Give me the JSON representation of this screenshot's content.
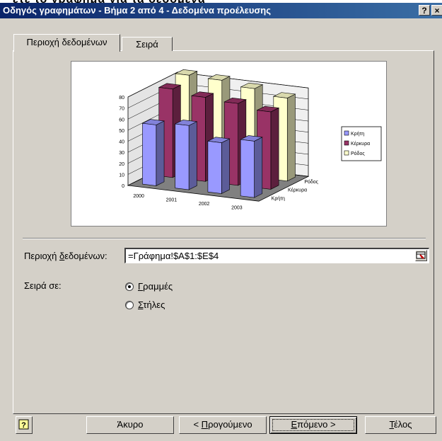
{
  "window": {
    "title": "Οδηγός γραφημάτων - Βήμα 2 από 4 - Δεδομένα προέλευσης",
    "help_btn": "?",
    "close_btn": "×",
    "behind_text": "ετε το γράφημα για τα δεδομένα"
  },
  "tabs": [
    {
      "label": "Περιοχή δεδομένων",
      "selected": true
    },
    {
      "label": "Σειρά",
      "selected": false
    }
  ],
  "form": {
    "data_range_label": "Περιοχή δεδομένων:",
    "data_range_label_pre": "Περιοχή ",
    "data_range_label_ul": "δ",
    "data_range_label_post": "εδομένων:",
    "data_range_value": "=Γράφημα!$A$1:$E$4",
    "series_in_label": "Σειρά σε:",
    "option_rows": {
      "ul": "Γ",
      "rest": "ραμμές",
      "selected": true
    },
    "option_cols": {
      "ul": "Σ",
      "rest": "τήλες",
      "selected": false
    }
  },
  "buttons": {
    "help_icon": "?",
    "cancel": "Άκυρο",
    "back_pre": "< ",
    "back_ul": "Π",
    "back_rest": "ρογούμενο",
    "next_ul": "Ε",
    "next_rest": "πόμενο >",
    "finish_ul": "Τ",
    "finish_rest": "έλος"
  },
  "chart_data": {
    "type": "bar",
    "categories": [
      "2000",
      "2001",
      "2002",
      "2003"
    ],
    "series": [
      {
        "name": "Κρήτη",
        "color": "#9999ff",
        "values": [
          55,
          58,
          46,
          51
        ]
      },
      {
        "name": "Κέρκυρα",
        "color": "#993366",
        "values": [
          80,
          76,
          74,
          70
        ]
      },
      {
        "name": "Ρόδος",
        "color": "#ffffcc",
        "values": [
          85,
          84,
          80,
          75
        ]
      }
    ],
    "depth_labels": [
      "Ρόδος",
      "Κέρκυρα",
      "Κρήτη"
    ],
    "yticks": [
      0,
      10,
      20,
      30,
      40,
      50,
      60,
      70,
      80
    ],
    "ylim": [
      0,
      80
    ],
    "legend": "right",
    "grid": true
  }
}
